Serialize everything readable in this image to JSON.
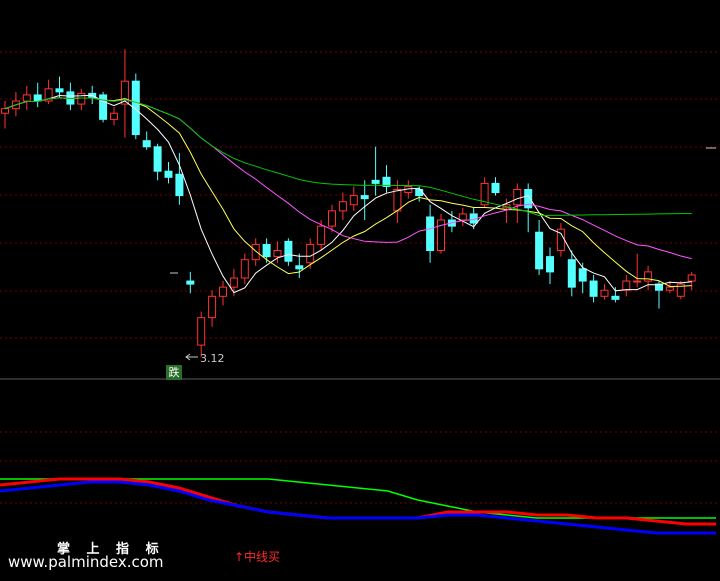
{
  "labels": {
    "signal_badge": "跌",
    "low_price_label": "3.12",
    "watermark_title": "掌 上 指 标",
    "watermark_url": "www.palmindex.com",
    "buy_signal": "↑中线买"
  },
  "colors": {
    "background": "#000000",
    "up_candle": "#ff3232",
    "down_candle": "#54ffff",
    "ma_short": "#ffffff",
    "ma_mid": "#ffff55",
    "ma_long": "#ff55ff",
    "ma_longest": "#00c800",
    "grid": "#7a0000",
    "line_green": "#00ff00",
    "line_red": "#ff0000",
    "line_blue": "#0000ff"
  },
  "chart_data": [
    {
      "type": "candlestick",
      "title": "",
      "low_marker": 3.12,
      "ohlc": [
        [
          4.72,
          4.8,
          4.62,
          4.75
        ],
        [
          4.75,
          4.86,
          4.7,
          4.8
        ],
        [
          4.8,
          4.9,
          4.74,
          4.84
        ],
        [
          4.84,
          4.92,
          4.76,
          4.8
        ],
        [
          4.8,
          4.94,
          4.78,
          4.88
        ],
        [
          4.88,
          4.96,
          4.82,
          4.86
        ],
        [
          4.86,
          4.92,
          4.74,
          4.78
        ],
        [
          4.78,
          4.88,
          4.74,
          4.85
        ],
        [
          4.85,
          4.9,
          4.78,
          4.82
        ],
        [
          4.84,
          4.86,
          4.66,
          4.68
        ],
        [
          4.68,
          4.76,
          4.64,
          4.72
        ],
        [
          4.78,
          5.14,
          4.56,
          4.93
        ],
        [
          4.93,
          4.98,
          4.55,
          4.58
        ],
        [
          4.54,
          4.6,
          4.48,
          4.5
        ],
        [
          4.5,
          4.52,
          4.28,
          4.34
        ],
        [
          4.34,
          4.4,
          4.26,
          4.3
        ],
        [
          4.32,
          4.46,
          4.12,
          4.18
        ],
        [
          3.62,
          3.68,
          3.54,
          3.6
        ],
        [
          3.2,
          3.42,
          3.12,
          3.38
        ],
        [
          3.38,
          3.56,
          3.32,
          3.52
        ],
        [
          3.52,
          3.62,
          3.46,
          3.58
        ],
        [
          3.58,
          3.7,
          3.52,
          3.64
        ],
        [
          3.64,
          3.8,
          3.6,
          3.76
        ],
        [
          3.76,
          3.9,
          3.72,
          3.86
        ],
        [
          3.86,
          3.9,
          3.74,
          3.78
        ],
        [
          3.78,
          3.88,
          3.74,
          3.82
        ],
        [
          3.88,
          3.9,
          3.72,
          3.75
        ],
        [
          3.72,
          3.8,
          3.64,
          3.7
        ],
        [
          3.74,
          3.9,
          3.7,
          3.86
        ],
        [
          3.86,
          4.02,
          3.82,
          3.98
        ],
        [
          3.98,
          4.12,
          3.94,
          4.08
        ],
        [
          4.08,
          4.2,
          4.02,
          4.14
        ],
        [
          4.12,
          4.24,
          4.08,
          4.18
        ],
        [
          4.18,
          4.28,
          4.02,
          4.16
        ],
        [
          4.28,
          4.5,
          4.18,
          4.26
        ],
        [
          4.3,
          4.38,
          4.2,
          4.24
        ],
        [
          4.08,
          4.28,
          4.0,
          4.22
        ],
        [
          4.2,
          4.28,
          4.16,
          4.24
        ],
        [
          4.22,
          4.24,
          4.14,
          4.18
        ],
        [
          4.04,
          4.12,
          3.74,
          3.82
        ],
        [
          3.82,
          4.06,
          3.8,
          4.02
        ],
        [
          4.02,
          4.08,
          3.94,
          3.98
        ],
        [
          4.02,
          4.1,
          3.98,
          4.06
        ],
        [
          4.06,
          4.1,
          3.96,
          4.0
        ],
        [
          4.12,
          4.3,
          4.1,
          4.26
        ],
        [
          4.26,
          4.3,
          4.18,
          4.2
        ],
        [
          4.1,
          4.16,
          4.0,
          4.12
        ],
        [
          4.12,
          4.26,
          4.0,
          4.22
        ],
        [
          4.22,
          4.26,
          3.94,
          4.1
        ],
        [
          3.94,
          4.02,
          3.66,
          3.7
        ],
        [
          3.78,
          3.84,
          3.6,
          3.68
        ],
        [
          3.82,
          4.0,
          3.78,
          3.96
        ],
        [
          3.76,
          3.82,
          3.52,
          3.58
        ],
        [
          3.7,
          3.74,
          3.54,
          3.62
        ],
        [
          3.62,
          3.66,
          3.48,
          3.52
        ],
        [
          3.52,
          3.6,
          3.5,
          3.56
        ],
        [
          3.52,
          3.58,
          3.48,
          3.5
        ],
        [
          3.56,
          3.66,
          3.52,
          3.62
        ],
        [
          3.62,
          3.8,
          3.58,
          3.62
        ],
        [
          3.62,
          3.72,
          3.56,
          3.68
        ],
        [
          3.6,
          3.62,
          3.44,
          3.56
        ],
        [
          3.56,
          3.62,
          3.54,
          3.58
        ],
        [
          3.52,
          3.62,
          3.5,
          3.6
        ],
        [
          3.62,
          3.68,
          3.56,
          3.66
        ]
      ]
    },
    {
      "type": "line",
      "series": [
        {
          "color": "green",
          "values": [
            47,
            47,
            47,
            47,
            47,
            47,
            47,
            47,
            47,
            47,
            46,
            45,
            44,
            43,
            40,
            38,
            36,
            35,
            34,
            34,
            34,
            34,
            34,
            34,
            34
          ]
        },
        {
          "color": "red",
          "values": [
            45,
            46,
            47,
            47,
            47,
            46,
            44,
            41,
            38,
            36,
            35,
            34,
            34,
            34,
            34,
            36,
            36,
            36,
            35,
            35,
            34,
            34,
            33,
            32,
            32
          ]
        },
        {
          "color": "blue",
          "values": [
            43,
            44,
            45,
            46,
            46,
            45,
            43,
            40,
            38,
            36,
            35,
            34,
            34,
            34,
            34,
            35,
            35,
            34,
            33,
            32,
            31,
            30,
            29,
            29,
            29
          ]
        }
      ]
    }
  ]
}
